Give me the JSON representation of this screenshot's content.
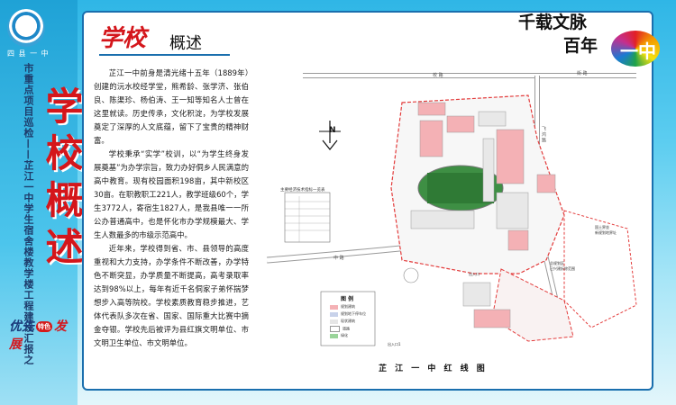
{
  "sidebar": {
    "logo_text": "四 县 一 中",
    "subtitle": "市重点项目巡检——芷江一中学生宿舍楼教学楼工程建设汇报之",
    "big_title": "学校概述",
    "slogan": {
      "left": "优先",
      "seal": "特色",
      "right": "发展"
    }
  },
  "panel": {
    "title_big": "学校",
    "title_small": "概述",
    "paragraphs": [
      "芷江一中前身是清光绪十五年（1889年）创建的沅水校经学堂，熊希龄、张学济、张伯良、陈渠珍、杨伯涛、王一知等知名人士曾在这里就读。历史传承，文化积淀，为学校发展奠定了深厚的人文底蕴，留下了宝贵的精神财富。",
      "学校秉承“实学”校训，以“为学生终身发展奠基”为办学宗旨，致力办好侗乡人民满意的高中教育。现有校园面积198亩，其中新校区30亩。在职教职工221人，教学班级60个，学生3772人，寄宿生1827人，是我县唯一一所公办普通高中，也是怀化市办学规模最大、学生人数最多的市级示范高中。",
      "近年来，学校得到省、市、县领导的高度重视和大力支持，办学条件不断改善，办学特色不断突显，办学质量不断提高，高考录取率达到98%以上，每年有近千名侗家子弟怀揣梦想步入高等院校。学校素质教育稳步推进，艺体代表队多次在省、国家、国际重大比赛中摘金夺银。学校先后被评为县红旗文明单位、市文明卫生单位、市文明单位。"
    ]
  },
  "tagline": {
    "line1": "千载文脉",
    "line2": "百年",
    "mark": "一中"
  },
  "map": {
    "caption": "芷 江 一 中 红 线 图",
    "north": "N",
    "table_title": "主要经济技术指标一览表",
    "legend_title": "图 例",
    "legend_items": [
      "规划建筑",
      "规划地下停车位",
      "现状建筑",
      "道路",
      "绿化"
    ],
    "legend_colors": [
      "#f4b1b5",
      "#c8d2ea",
      "#e6e6e6",
      "#ffffff",
      "#9ad49a"
    ],
    "road_labels": [
      "校 路",
      "街 路",
      "中 路",
      "飞 鸿 路"
    ],
    "notes": [
      "国土界坐",
      "新规划地界址",
      "总规划区",
      "已兴建拆除范围",
      "出入口1",
      "出入口"
    ]
  },
  "colors": {
    "accent_red": "#d4161b",
    "frame_blue": "#1a6fae",
    "sky_blue": "#2fb6e6"
  }
}
